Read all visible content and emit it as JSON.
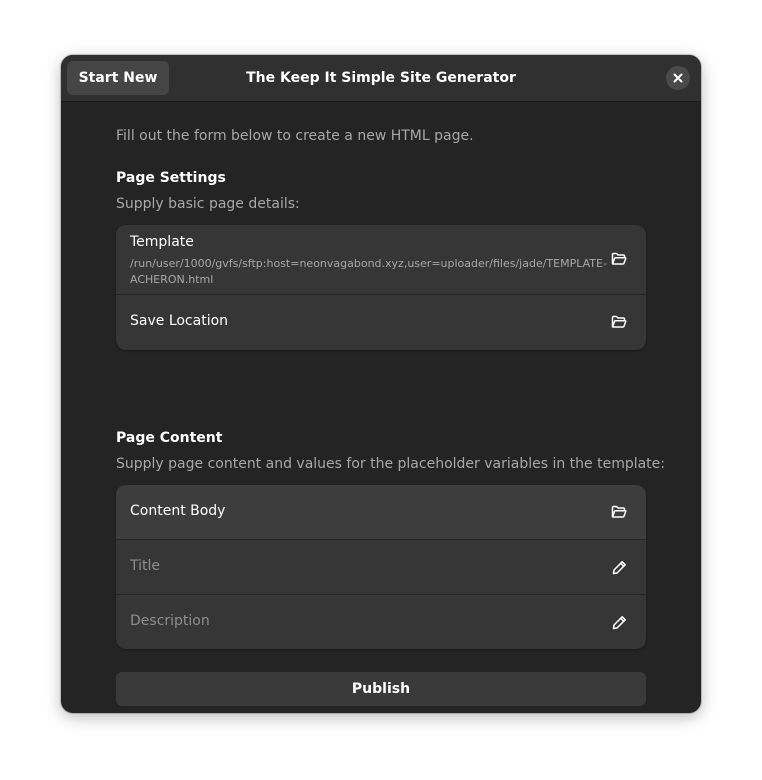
{
  "header": {
    "start_new_label": "Start New",
    "title": "The Keep It Simple Site Generator",
    "close_icon": "close-icon"
  },
  "intro": "Fill out the form below to create a new HTML page.",
  "page_settings": {
    "heading": "Page Settings",
    "subtitle": "Supply basic page details:",
    "rows": [
      {
        "label": "Template",
        "value": "/run/user/1000/gvfs/sftp:host=neonvagabond.xyz,user=uploader/files/jade/TEMPLATE-ACHERON.html",
        "icon": "folder-open-icon"
      },
      {
        "label": "Save Location",
        "icon": "folder-open-icon"
      }
    ]
  },
  "page_content": {
    "heading": "Page Content",
    "subtitle": "Supply page content and values for the placeholder variables in the template:",
    "rows": [
      {
        "label": "Content Body",
        "icon": "folder-open-icon"
      },
      {
        "placeholder": "Title",
        "icon": "pencil-icon"
      },
      {
        "placeholder": "Description",
        "icon": "pencil-icon"
      }
    ]
  },
  "publish_label": "Publish",
  "colors": {
    "window_bg": "#242424",
    "headerbar_bg": "#303030",
    "card_bg": "#363636",
    "dim_text": "#a8a8a8"
  }
}
